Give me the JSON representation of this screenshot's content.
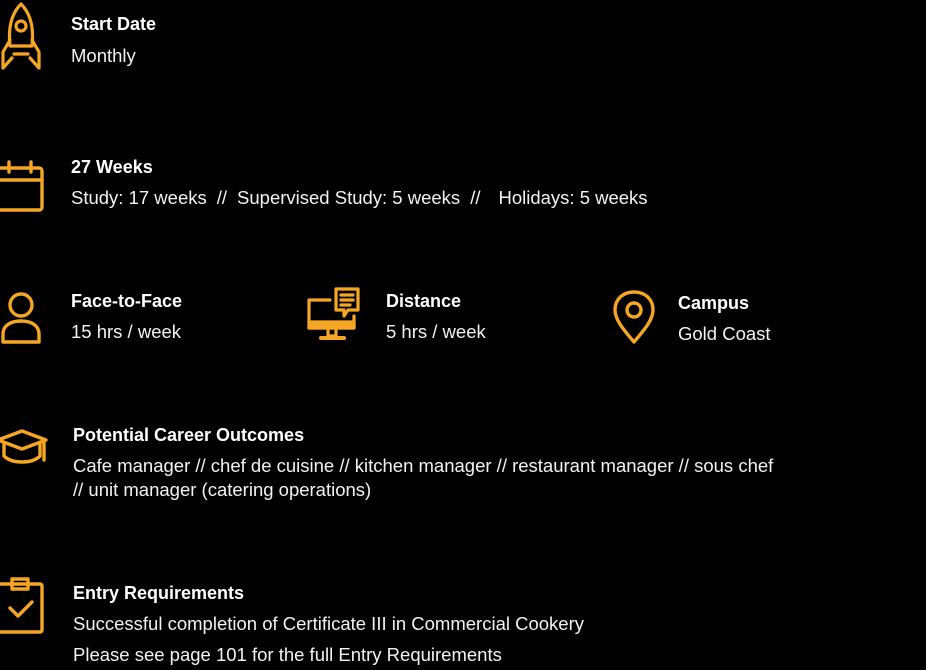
{
  "accent_color": "#F5A623",
  "start": {
    "icon": "rocket-icon",
    "title": "Start Date",
    "value": "Monthly"
  },
  "duration": {
    "icon": "calendar-icon",
    "title": "27 Weeks",
    "study": "Study: 17 weeks",
    "separator": "//",
    "supervised": "Supervised Study: 5 weeks",
    "holidays": "Holidays: 5 weeks"
  },
  "face_to_face": {
    "icon": "person-icon",
    "title": "Face-to-Face",
    "value": "15 hrs / week"
  },
  "distance": {
    "icon": "monitor-chat-icon",
    "title": "Distance",
    "value": "5 hrs / week"
  },
  "campus": {
    "icon": "location-pin-icon",
    "title": "Campus",
    "value": "Gold Coast"
  },
  "career": {
    "icon": "graduation-cap-icon",
    "title": "Potential Career Outcomes",
    "line1": "Cafe manager // chef de cuisine // kitchen manager // restaurant manager // sous chef",
    "line2": "// unit manager (catering operations)"
  },
  "entry": {
    "icon": "clipboard-check-icon",
    "title": "Entry Requirements",
    "line1": "Successful completion of Certificate III in Commercial Cookery",
    "line2": "Please see page 101 for the full Entry Requirements"
  }
}
